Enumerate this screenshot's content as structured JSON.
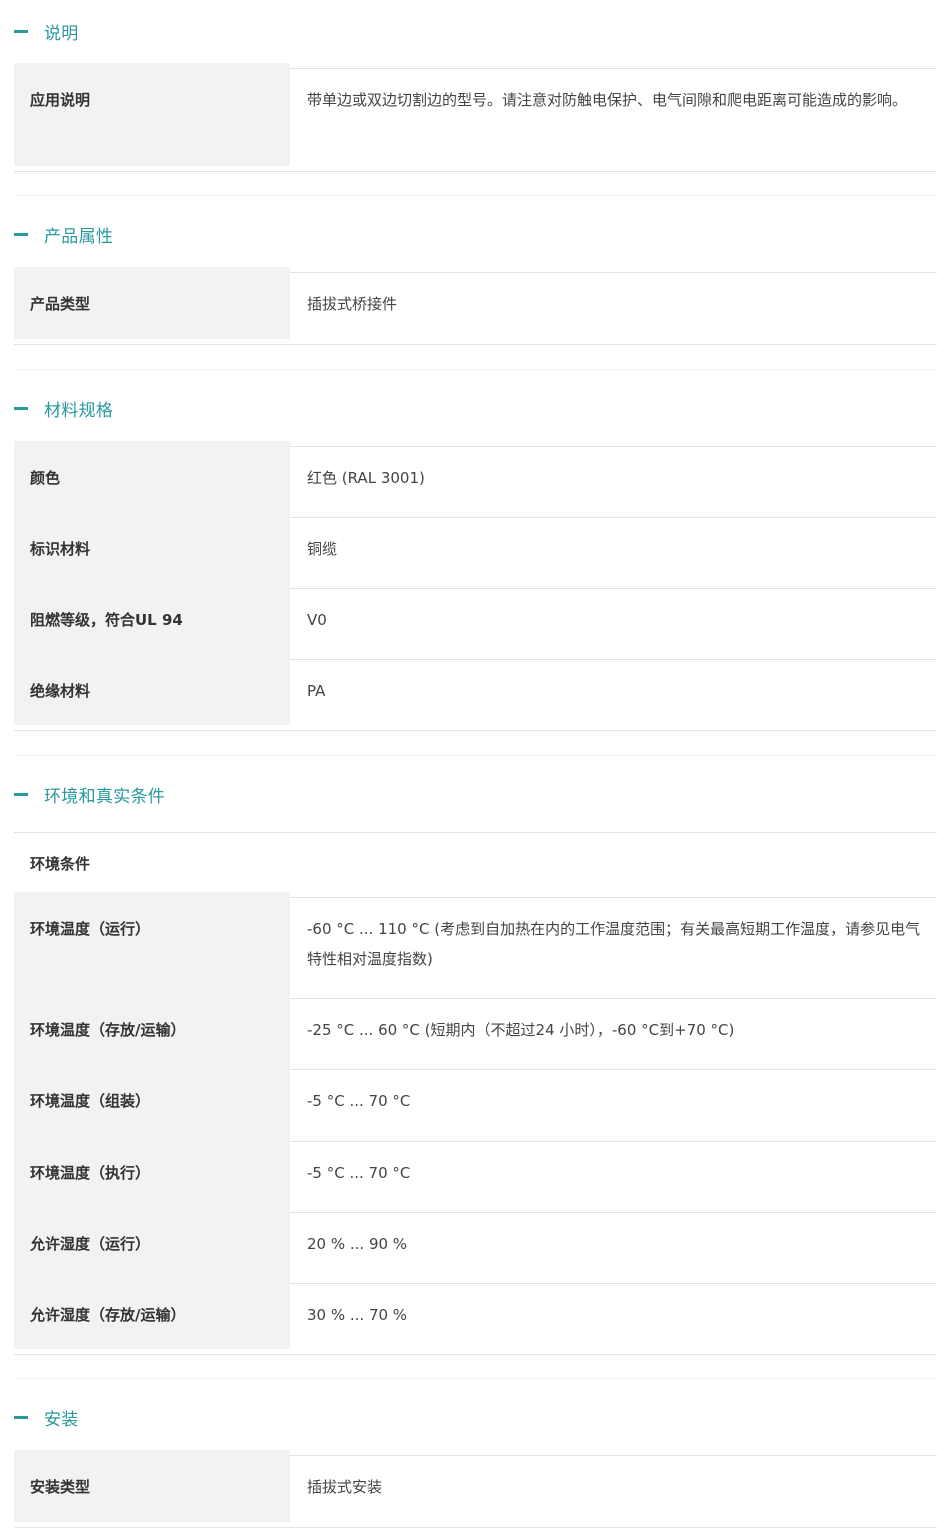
{
  "sections": [
    {
      "title": "说明",
      "rows": [
        {
          "label": "应用说明",
          "value": "带单边或双边切割边的型号。请注意对防触电保护、电气间隙和爬电距离可能造成的影响。"
        }
      ]
    },
    {
      "title": "产品属性",
      "rows": [
        {
          "label": "产品类型",
          "value": "插拔式桥接件"
        }
      ]
    },
    {
      "title": "材料规格",
      "rows": [
        {
          "label": "颜色",
          "value": "红色 (RAL 3001)"
        },
        {
          "label": "标识材料",
          "value": "铜缆"
        },
        {
          "label": "阻燃等级，符合UL 94",
          "value": "V0"
        },
        {
          "label": "绝缘材料",
          "value": "PA"
        }
      ]
    },
    {
      "title": "环境和真实条件",
      "subheader": "环境条件",
      "rows": [
        {
          "label": "环境温度（运行）",
          "value": "-60 °C ... 110 °C (考虑到自加热在内的工作温度范围；有关最高短期工作温度，请参见电气特性相对温度指数)"
        },
        {
          "label": "环境温度（存放/运输）",
          "value": "-25 °C ... 60 °C (短期内（不超过24  小时），-60 °C到+70 °C)"
        },
        {
          "label": "环境温度（组装）",
          "value": "-5 °C ... 70 °C"
        },
        {
          "label": "环境温度（执行）",
          "value": "-5 °C ... 70 °C"
        },
        {
          "label": "允许湿度（运行）",
          "value": "20 % ... 90 %"
        },
        {
          "label": "允许湿度（存放/运输）",
          "value": "30 % ... 70 %"
        }
      ]
    },
    {
      "title": "安装",
      "rows": [
        {
          "label": "安装类型",
          "value": "插拔式安装"
        }
      ]
    }
  ],
  "colors": {
    "accent": "#2a9a9f",
    "label_bg": "#f2f2f2",
    "border": "#e3e3e3"
  },
  "icons": {
    "collapse": "minus-icon"
  }
}
